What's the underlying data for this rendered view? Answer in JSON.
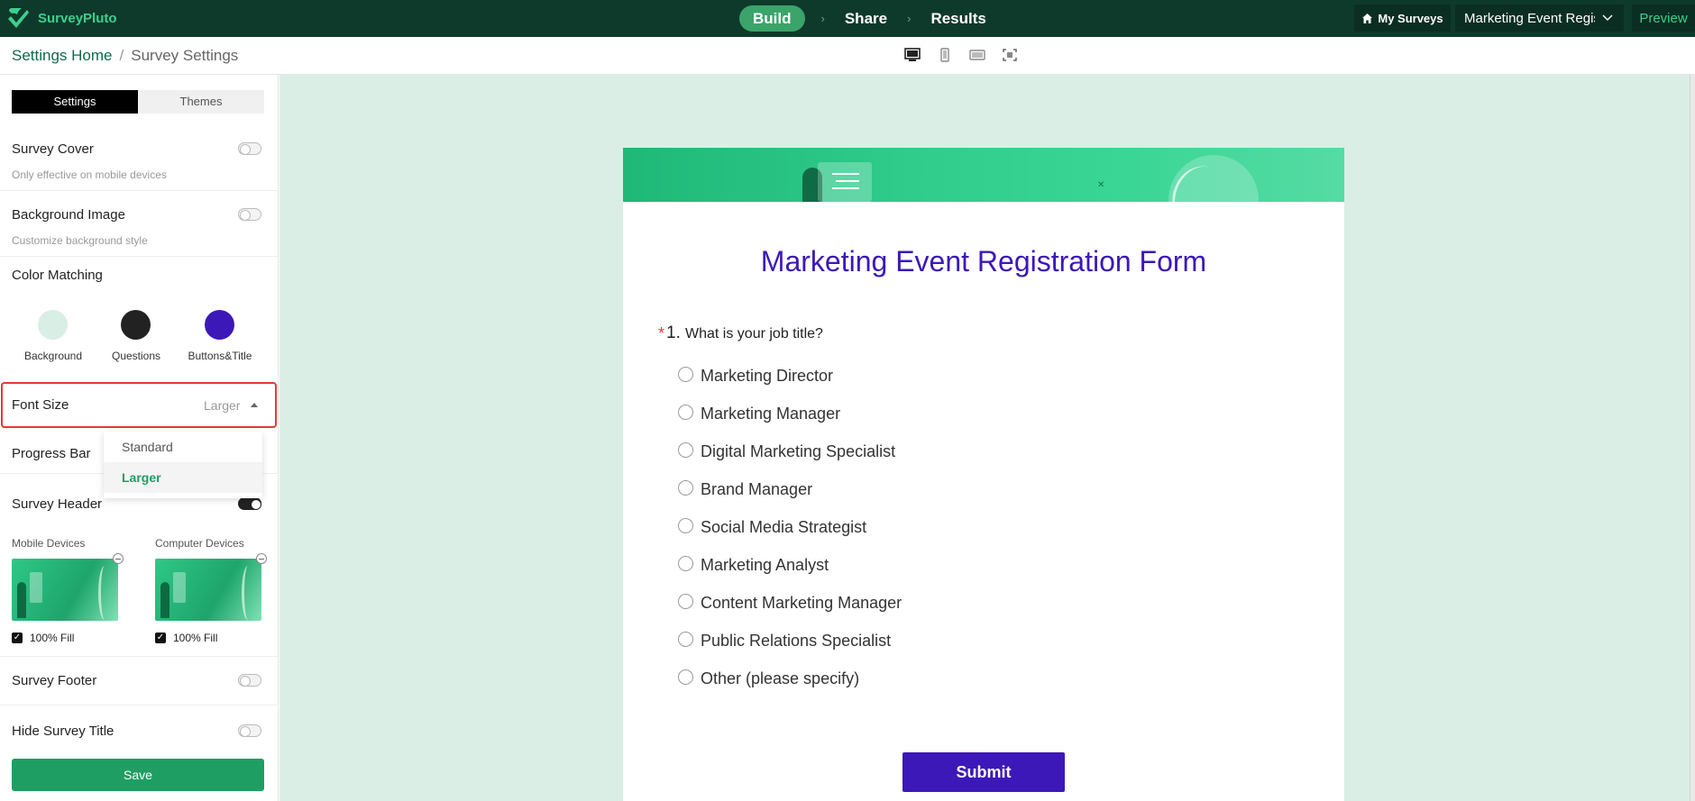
{
  "topbar": {
    "brand": "SurveyPluto",
    "steps": [
      {
        "label": "Build",
        "active": true
      },
      {
        "label": "Share",
        "active": false
      },
      {
        "label": "Results",
        "active": false
      }
    ],
    "my_surveys": "My Surveys",
    "survey_select": "Marketing Event Registration Form",
    "preview": "Preview"
  },
  "breadcrumb": {
    "home": "Settings Home",
    "separator": "/",
    "current": "Survey Settings"
  },
  "device_icons": [
    "desktop-icon",
    "mobile-icon",
    "tablet-icon",
    "fullscreen-icon"
  ],
  "panel": {
    "tabs": [
      {
        "label": "Settings",
        "active": true
      },
      {
        "label": "Themes",
        "active": false
      }
    ],
    "survey_cover": {
      "title": "Survey Cover",
      "desc": "Only effective on mobile devices",
      "enabled": false
    },
    "background_image": {
      "title": "Background Image",
      "desc": "Customize background style",
      "enabled": false
    },
    "color_matching": {
      "title": "Color Matching",
      "swatches": [
        {
          "label": "Background",
          "color": "#d9eee4"
        },
        {
          "label": "Questions",
          "color": "#222222"
        },
        {
          "label": "Buttons&Title",
          "color": "#3c18b8"
        }
      ]
    },
    "font_size": {
      "title": "Font Size",
      "value": "Larger",
      "options": [
        {
          "label": "Standard",
          "selected": false
        },
        {
          "label": "Larger",
          "selected": true
        }
      ]
    },
    "progress_bar": {
      "title": "Progress Bar"
    },
    "survey_header": {
      "title": "Survey Header",
      "enabled": true,
      "mobile_label": "Mobile Devices",
      "computer_label": "Computer Devices",
      "mobile_fill": "100% Fill",
      "computer_fill": "100% Fill"
    },
    "survey_footer": {
      "title": "Survey Footer",
      "enabled": false
    },
    "hide_survey_title": {
      "title": "Hide Survey Title",
      "enabled": false
    },
    "save": "Save"
  },
  "form": {
    "title": "Marketing Event Registration Form",
    "question": {
      "required_mark": "*",
      "number": "1.",
      "text": "What is your job title?",
      "options": [
        "Marketing Director",
        "Marketing Manager",
        "Digital Marketing Specialist",
        "Brand Manager",
        "Social Media Strategist",
        "Marketing Analyst",
        "Content Marketing Manager",
        "Public Relations Specialist",
        "Other (please specify)"
      ]
    },
    "submit": "Submit"
  },
  "colors": {
    "topbar": "#0e3a2b",
    "accent_green": "#1e9e63",
    "title_purple": "#3c18b8",
    "canvas_bg": "#dbeee5",
    "highlight_red": "#e53935"
  }
}
